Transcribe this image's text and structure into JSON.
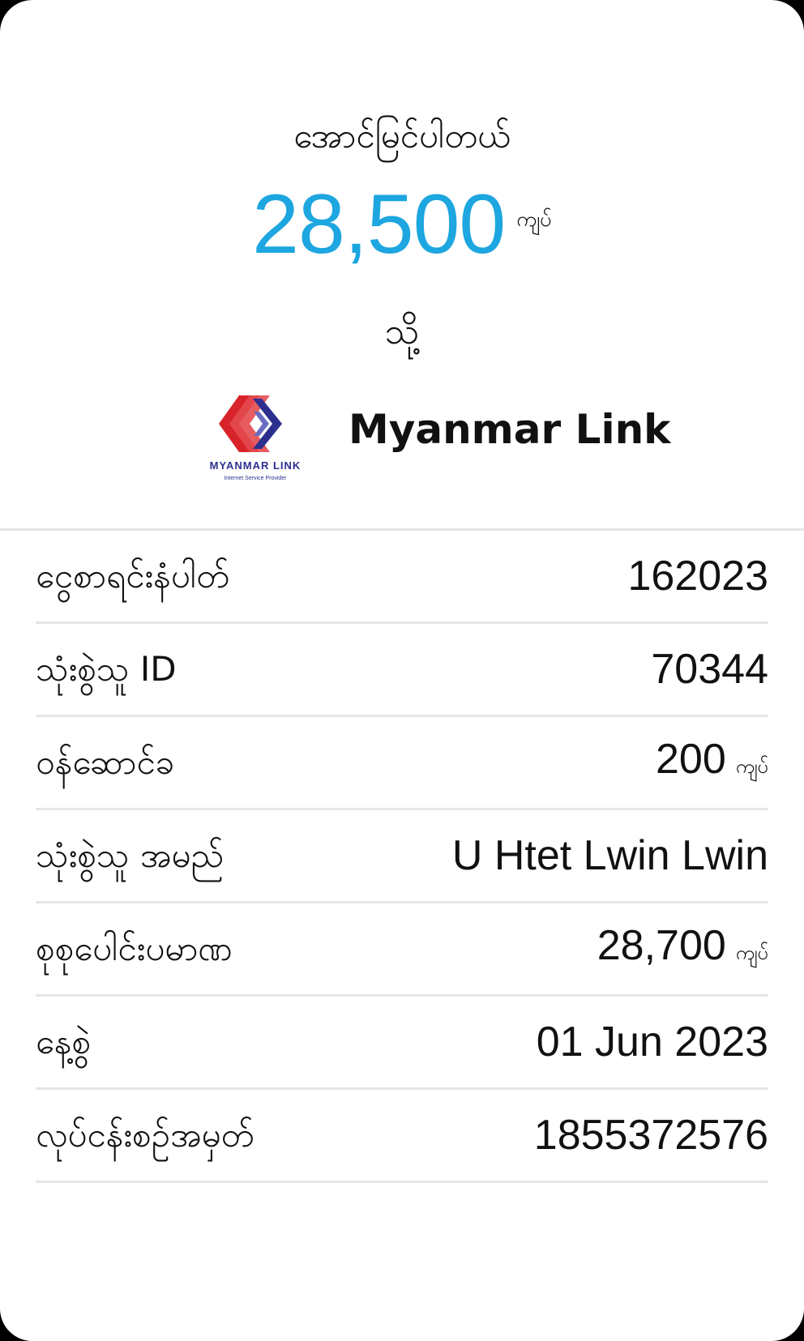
{
  "status_text": "အောင်မြင်ပါတယ်",
  "amount": "28,500",
  "amount_unit": "ကျပ်",
  "to_label": "သို့",
  "merchant": {
    "logo_text": "MYANMAR LINK",
    "logo_subtext": "Internet Service Provider",
    "name": "Myanmar Link"
  },
  "details": [
    {
      "label": "ငွေစာရင်းနံပါတ်",
      "value": "162023",
      "unit": ""
    },
    {
      "label": "သုံးစွဲသူ ID",
      "value": "70344",
      "unit": ""
    },
    {
      "label": "ဝန်ဆောင်ခ",
      "value": "200",
      "unit": "ကျပ်"
    },
    {
      "label": "သုံးစွဲသူ အမည်",
      "value": "U Htet Lwin Lwin",
      "unit": ""
    },
    {
      "label": "စုစုပေါင်းပမာဏ",
      "value": "28,700",
      "unit": "ကျပ်"
    },
    {
      "label": "နေ့စွဲ",
      "value": "01 Jun 2023",
      "unit": ""
    },
    {
      "label": "လုပ်ငန်းစဉ်အမှတ်",
      "value": "1855372576",
      "unit": ""
    }
  ],
  "colors": {
    "amount": "#1da6e0",
    "logo_red": "#d8232a",
    "logo_blue": "#2d2f8f"
  }
}
